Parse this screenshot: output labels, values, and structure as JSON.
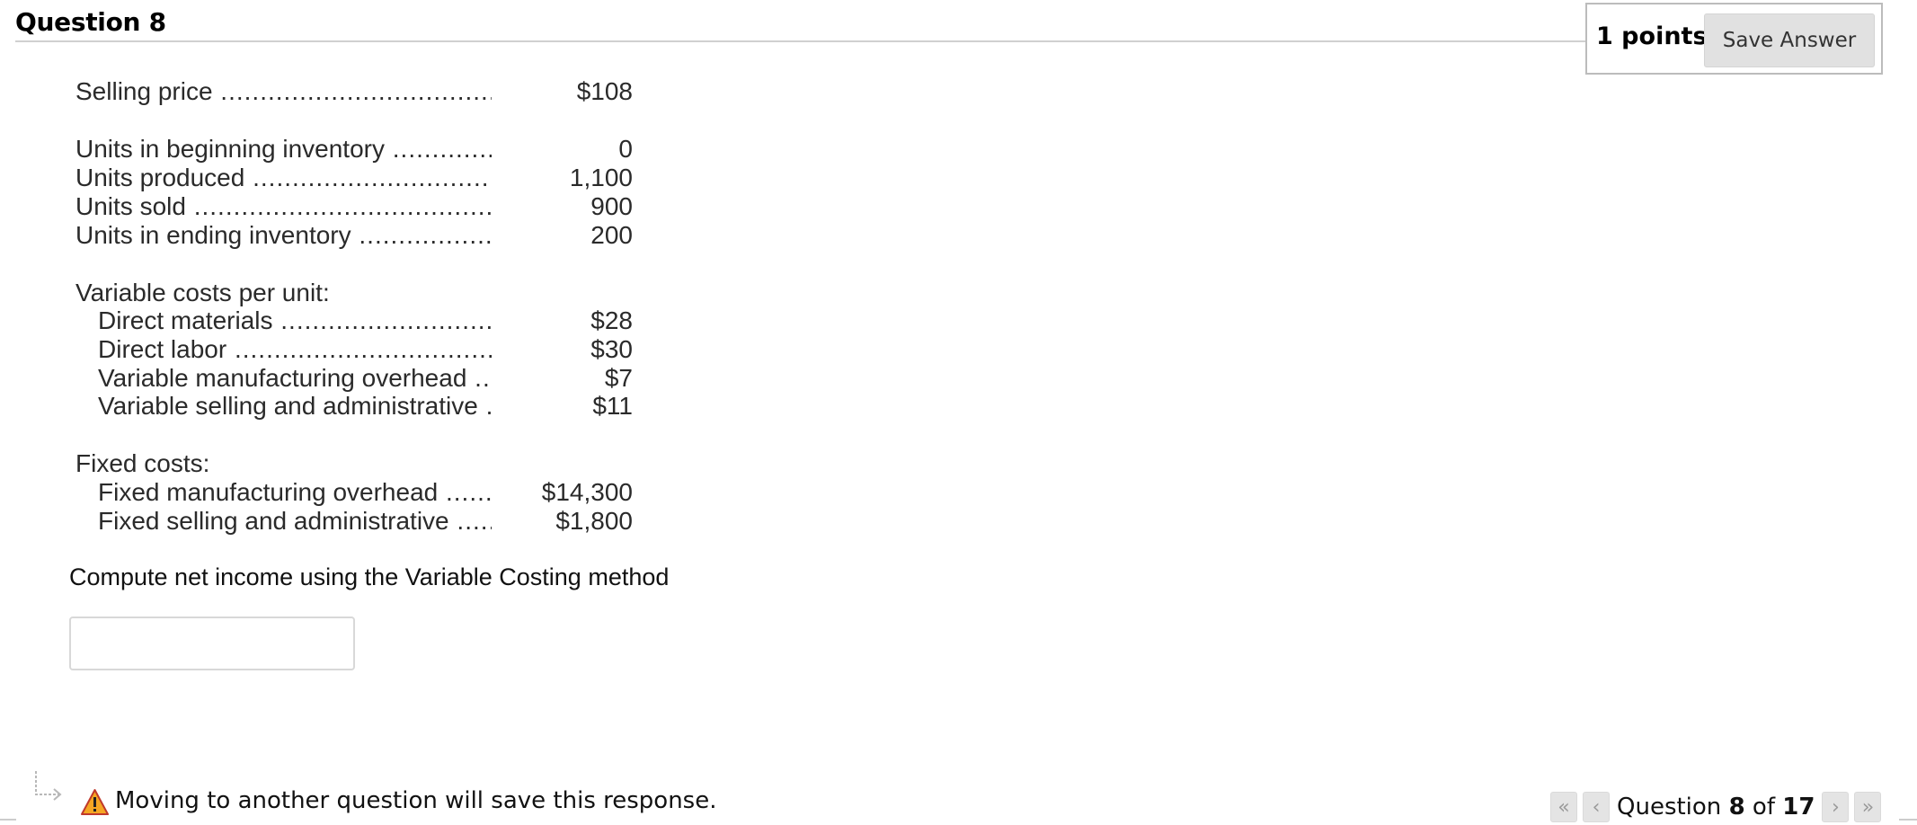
{
  "header": {
    "title": "Question 8",
    "points": "1 points",
    "save_label": "Save Answer"
  },
  "figures": {
    "selling_price": {
      "label": "Selling price",
      "value": "$108"
    },
    "inventory": [
      {
        "label": "Units in beginning inventory",
        "value": "0"
      },
      {
        "label": "Units produced",
        "value": "1,100"
      },
      {
        "label": "Units sold",
        "value": "900"
      },
      {
        "label": "Units in ending inventory",
        "value": "200"
      }
    ],
    "variable_heading": "Variable costs per unit:",
    "variable": [
      {
        "label": "Direct materials",
        "value": "$28"
      },
      {
        "label": "Direct labor",
        "value": "$30"
      },
      {
        "label": "Variable manufacturing overhead",
        "value": "$7"
      },
      {
        "label": "Variable selling and administrative",
        "value": "$11"
      }
    ],
    "fixed_heading": "Fixed costs:",
    "fixed": [
      {
        "label": "Fixed manufacturing overhead",
        "value": "$14,300"
      },
      {
        "label": "Fixed selling and administrative",
        "value": "$1,800"
      }
    ]
  },
  "prompt": "Compute net income using the Variable Costing method",
  "answer": {
    "value": "",
    "placeholder": ""
  },
  "footer": {
    "warning": "Moving to another question will save this response.",
    "nav_prefix": "Question",
    "current": "8",
    "nav_of": "of",
    "total": "17",
    "first_icon": "double-chevron-left-icon",
    "prev_icon": "chevron-left-icon",
    "next_icon": "chevron-right-icon",
    "last_icon": "double-chevron-right-icon",
    "warning_icon": "warning-triangle-icon"
  },
  "colors": {
    "button_bg": "#e1e1e1",
    "warning": "#f5a623"
  }
}
